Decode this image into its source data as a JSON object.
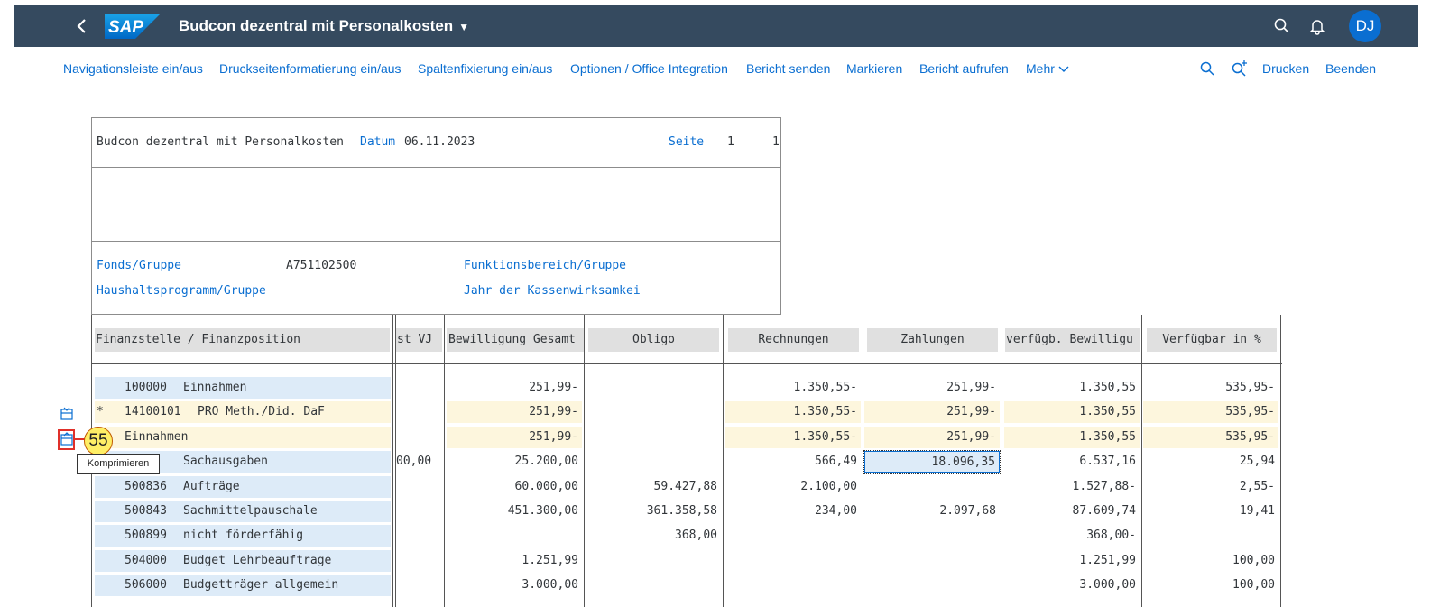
{
  "shell": {
    "title": "Budcon dezentral mit Personalkosten",
    "caret": "▼",
    "logo_text": "SAP",
    "avatar_initials": "DJ"
  },
  "toolbar": {
    "items": [
      "Navigationsleiste ein/aus",
      "Druckseitenformatierung ein/aus",
      "Spaltenfixierung ein/aus",
      "Optionen / Office Integration",
      "Bericht senden",
      "Markieren",
      "Bericht aufrufen",
      "Mehr"
    ],
    "print_label": "Drucken",
    "exit_label": "Beenden"
  },
  "report_header": {
    "title": "Budcon dezentral mit Personalkosten",
    "date_label": "Datum",
    "date_value": "06.11.2023",
    "page_label": "Seite",
    "page_value": "1",
    "page_total": "1",
    "fonds_label": "Fonds/Gruppe",
    "fonds_value": "A751102500",
    "funktionsbereich_label": "Funktionsbereich/Gruppe",
    "haushaltsprogramm_label": "Haushaltsprogramm/Gruppe",
    "jahr_label": "Jahr der Kassenwirksamkei"
  },
  "table": {
    "headers": [
      "Finanzstelle / Finanzposition",
      "st VJ",
      "Bewilligung Gesamt",
      "Obligo",
      "Rechnungen",
      "Zahlungen",
      "verfügb. Bewilligu",
      "Verfügbar in %"
    ],
    "rows": [
      {
        "star": "",
        "code": "100000",
        "name": "Einnahmen",
        "vj": "",
        "bew": "251,99-",
        "obligo": "",
        "rech": "1.350,55-",
        "zahl": "251,99-",
        "verf": "1.350,55",
        "pct": "535,95-"
      },
      {
        "star": "*",
        "code": "14100101",
        "name": "PRO Meth./Did. DaF",
        "vj": "",
        "bew": "251,99-",
        "obligo": "",
        "rech": "1.350,55-",
        "zahl": "251,99-",
        "verf": "1.350,55",
        "pct": "535,95-"
      },
      {
        "star": "",
        "code": "",
        "name": "Einnahmen",
        "vj": "",
        "bew": "251,99-",
        "obligo": "",
        "rech": "1.350,55-",
        "zahl": "251,99-",
        "verf": "1.350,55",
        "pct": "535,95-"
      },
      {
        "star": "",
        "code": "0",
        "name": "Sachausgaben",
        "vj": "00,00",
        "bew": "25.200,00",
        "obligo": "",
        "rech": "566,49",
        "zahl": "18.096,35",
        "verf": "6.537,16",
        "pct": "25,94"
      },
      {
        "star": "",
        "code": "500836",
        "name": "Aufträge",
        "vj": "",
        "bew": "60.000,00",
        "obligo": "59.427,88",
        "rech": "2.100,00",
        "zahl": "",
        "verf": "1.527,88-",
        "pct": "2,55-"
      },
      {
        "star": "",
        "code": "500843",
        "name": "Sachmittelpauschale",
        "vj": "",
        "bew": "451.300,00",
        "obligo": "361.358,58",
        "rech": "234,00",
        "zahl": "2.097,68",
        "verf": "87.609,74",
        "pct": "19,41"
      },
      {
        "star": "",
        "code": "500899",
        "name": "nicht förderfähig",
        "vj": "",
        "bew": "",
        "obligo": "368,00",
        "rech": "",
        "zahl": "",
        "verf": "368,00-",
        "pct": ""
      },
      {
        "star": "",
        "code": "504000",
        "name": "Budget Lehrbeauftrage",
        "vj": "",
        "bew": "1.251,99",
        "obligo": "",
        "rech": "",
        "zahl": "",
        "verf": "1.251,99",
        "pct": "100,00"
      },
      {
        "star": "",
        "code": "506000",
        "name": "Budgetträger allgemein",
        "vj": "",
        "bew": "3.000,00",
        "obligo": "",
        "rech": "",
        "zahl": "",
        "verf": "3.000,00",
        "pct": "100,00"
      }
    ]
  },
  "annotation": {
    "badge_number": "55",
    "tooltip": "Komprimieren"
  },
  "colors": {
    "shell_bg": "#354a5f",
    "link_blue": "#0a6ed1",
    "row_blue": "#ddebf8",
    "row_cream": "#fdf6dd",
    "highlight_red": "#e0302a",
    "badge_yellow": "#ffef66"
  },
  "icons": [
    "back-icon",
    "search-icon",
    "bell-icon",
    "zoom-in-icon",
    "chevron-down-icon",
    "expand-node-icon",
    "collapse-node-icon"
  ]
}
